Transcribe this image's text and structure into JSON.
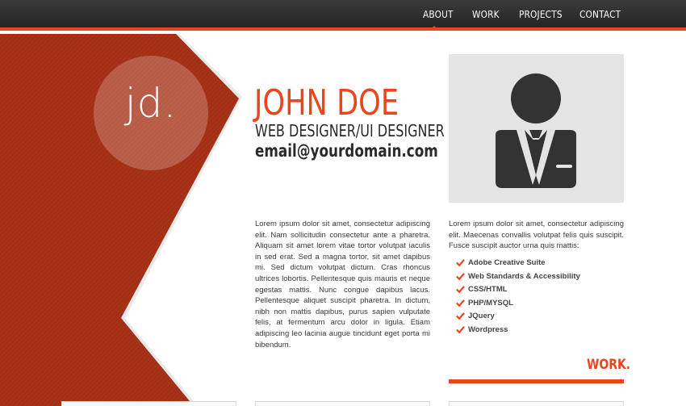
{
  "nav": {
    "items": [
      {
        "label": "ABOUT",
        "active": true
      },
      {
        "label": "WORK"
      },
      {
        "label": "PROJECTS"
      },
      {
        "label": "CONTACT"
      }
    ]
  },
  "colors": {
    "accent": "#e8461e",
    "chevron": "#a83218",
    "topbar": "#2e2e2e"
  },
  "logo": {
    "text": "jd."
  },
  "profile": {
    "name": "JOHN DOE",
    "role": "WEB DESIGNER/UI DESIGNER",
    "email": "email@yourdomain.com",
    "avatar_icon": "person-icon"
  },
  "about": {
    "left_text": "Lorem ipsum dolor sit amet, consectetur adipiscing elit. Nam sollicitudin consectetur ante a pharetra. Aliquam sit amet lorem vitae tortor volutpat iaculis in sed erat. Sed a magna tortor, sit amet dapibus mi. Sed dictum volutpat dictum. Cras rhoncus ultrices lobortis. Pellentesque quis mauris et neque egestas mattis. Nunc congue dapibus lacus. Pellentesque aliquet suscipit pharetra. In dictum, nibh non mattis dapibus, purus sapien vulputate felis, at fermentum arcu dolor in ligula. Etiam adipiscing leo lacinia augue tincidunt eget porta mi bibendum.",
    "right_text": "Lorem ipsum dolor sit amet, consectetur adipiscing elit. Maecenas convallis volutpat felis quis suscipit. Fusce suscipit auctor urna quis mattis:",
    "skills": [
      "Adobe Creative Suite",
      "Web Standards & Accessibility",
      "CSS/HTML",
      "PHP/MYSQL",
      "JQuery",
      "Wordpress"
    ]
  },
  "work": {
    "heading": "WORK."
  }
}
